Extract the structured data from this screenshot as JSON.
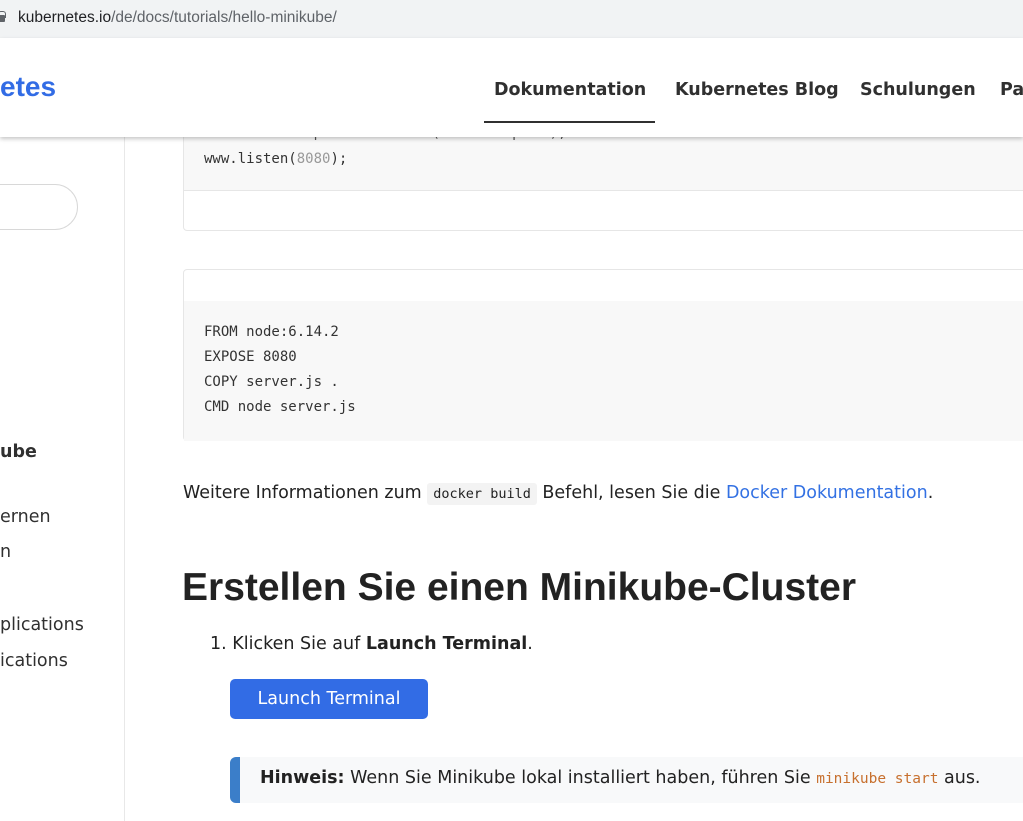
{
  "browser": {
    "url_domain": "kubernetes.io",
    "url_path": "/de/docs/tutorials/hello-minikube/"
  },
  "header": {
    "logo_text": "etes",
    "nav": {
      "doc": "Dokumentation",
      "blog": "Kubernetes Blog",
      "training": "Schulungen",
      "partner_partial": "Pa"
    }
  },
  "sidebar": {
    "items": [
      "ube",
      "ernen",
      "n",
      "plications",
      "ications"
    ]
  },
  "code1": {
    "line_partial_kw": "var",
    "line_partial_rest": " www = http.createServer(handleRequest);",
    "line2_prefix": "www.listen(",
    "line2_num": "8080",
    "line2_suffix": ");"
  },
  "code2": {
    "lines": [
      "FROM node:6.14.2",
      "EXPOSE 8080",
      "COPY server.js .",
      "CMD node server.js"
    ]
  },
  "paragraph": {
    "before": "Weitere Informationen zum ",
    "code": "docker build",
    "middle": " Befehl, lesen Sie die ",
    "link": "Docker Dokumentation",
    "after": "."
  },
  "section": {
    "heading": "Erstellen Sie einen Minikube-Cluster"
  },
  "steps": {
    "one_prefix": "1. Klicken Sie auf ",
    "one_bold": "Launch Terminal",
    "one_suffix": "."
  },
  "button": {
    "launch_label": "Launch Terminal"
  },
  "note": {
    "label": "Hinweis:",
    "text_before": " Wenn Sie Minikube lokal installiert haben, führen Sie ",
    "code": "minikube start",
    "text_after": " aus."
  },
  "colors": {
    "brand": "#326ce5",
    "link": "#3371e3",
    "note_border": "#3b7ec9",
    "code_orange": "#c7702e"
  }
}
